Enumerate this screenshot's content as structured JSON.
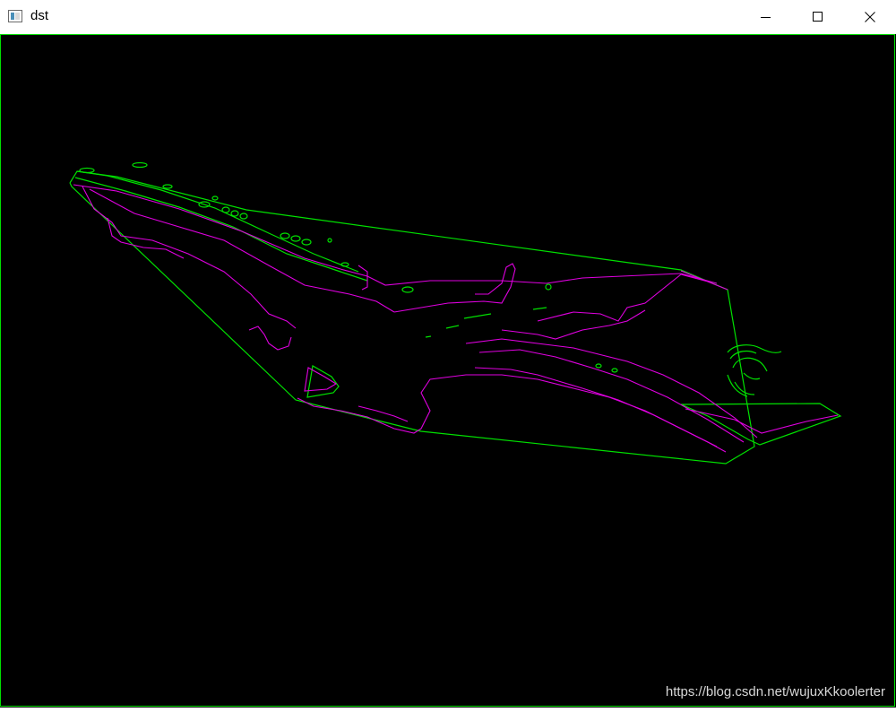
{
  "window": {
    "title": "dst",
    "controls": {
      "minimize_icon": "minimize-icon",
      "maximize_icon": "maximize-icon",
      "close_icon": "close-icon"
    }
  },
  "image": {
    "background": "#000000",
    "hull_color": "#00e000",
    "contour_color": "#e000e0",
    "watermark": "https://blog.csdn.net/wujuxKkoolerter"
  }
}
